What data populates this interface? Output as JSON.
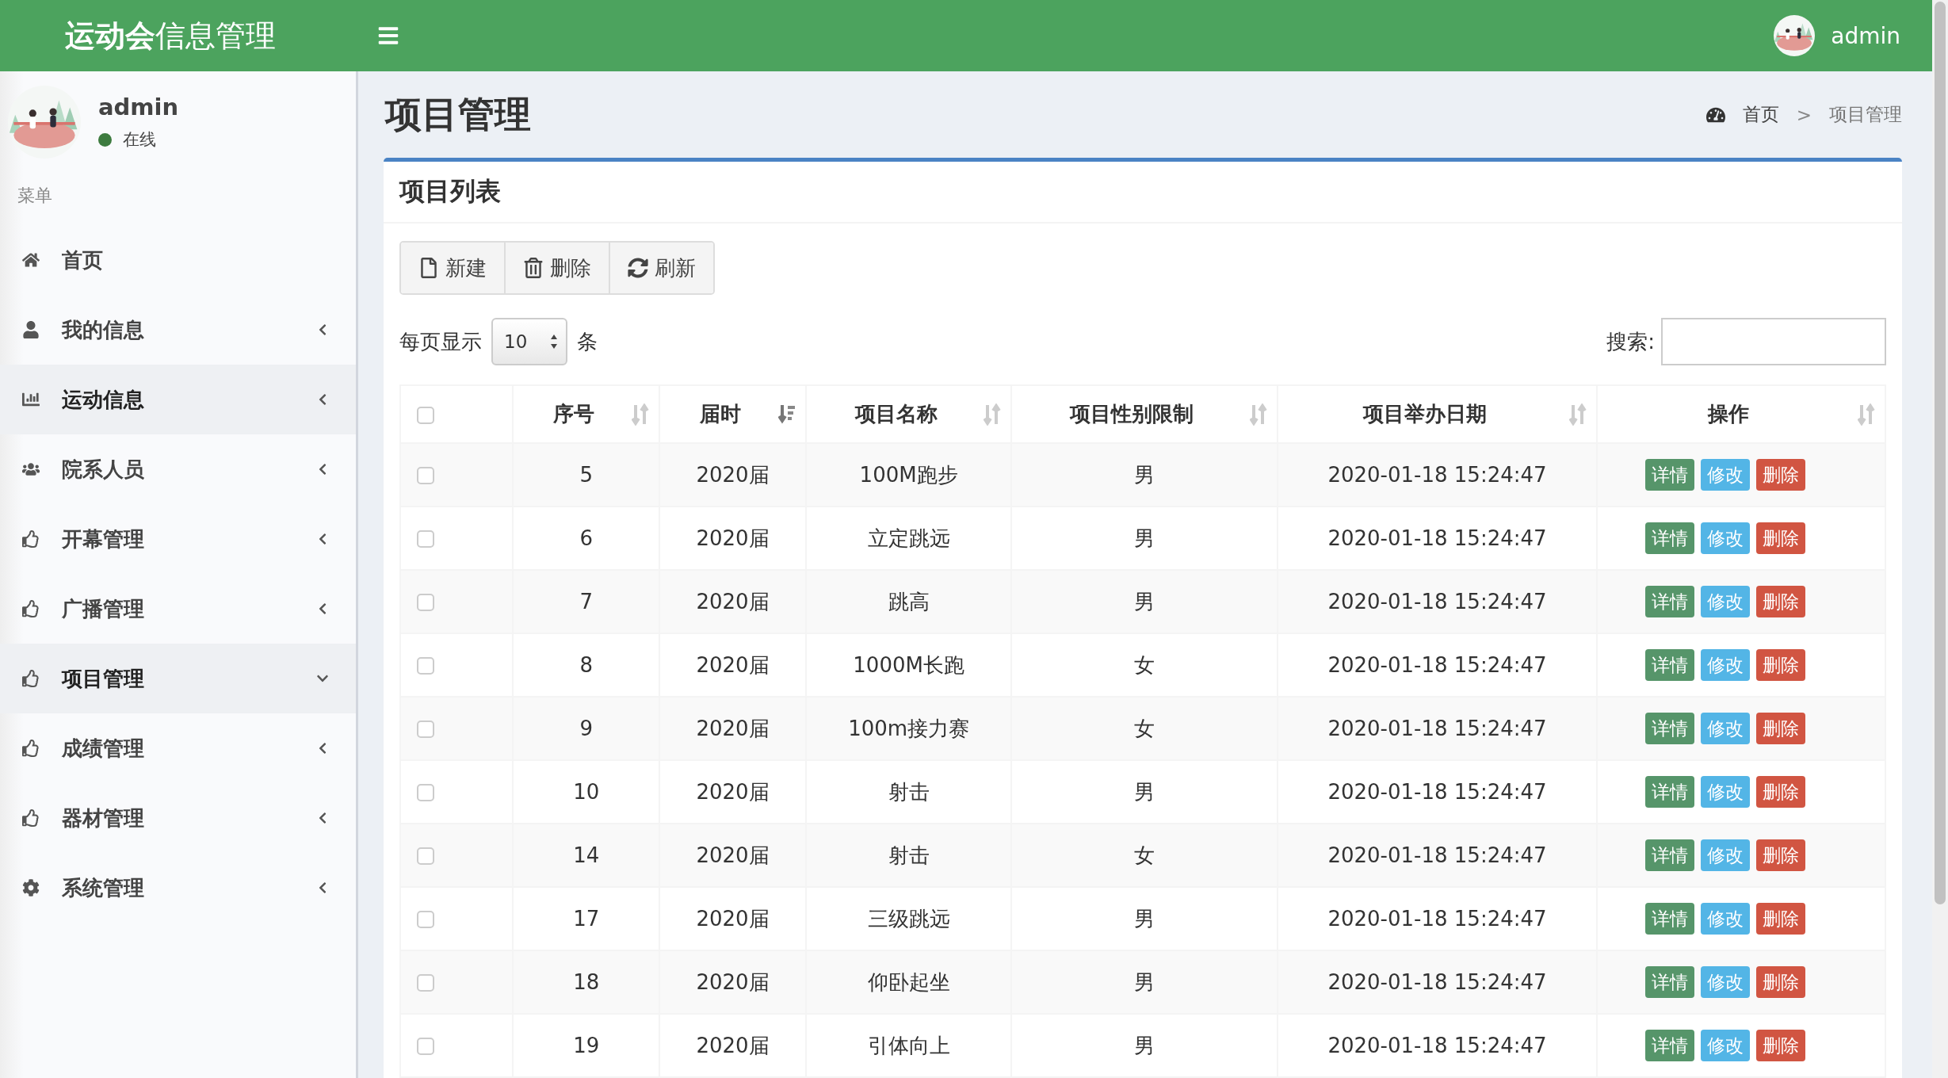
{
  "header": {
    "title": "**运动会**信息管理",
    "user": "admin"
  },
  "sidebar": {
    "user": {
      "name": "admin",
      "status": "在线"
    },
    "menu_label": "菜单",
    "items": [
      {
        "label": "首页",
        "highlighted": false
      },
      {
        "label": "我的信息",
        "highlighted": false,
        "expanded": false
      },
      {
        "label": "运动信息",
        "highlighted": true,
        "expanded": false
      },
      {
        "label": "院系人员",
        "highlighted": false,
        "expanded": false
      },
      {
        "label": "开幕管理",
        "highlighted": false,
        "expanded": false
      },
      {
        "label": "广播管理",
        "highlighted": false,
        "expanded": false
      },
      {
        "label": "项目管理",
        "highlighted": true,
        "expanded": true
      },
      {
        "label": "成绩管理",
        "highlighted": false,
        "expanded": false
      },
      {
        "label": "器材管理",
        "highlighted": false,
        "expanded": false
      },
      {
        "label": "系统管理",
        "highlighted": false,
        "expanded": false
      }
    ]
  },
  "page": {
    "title": "项目管理",
    "breadcrumb": {
      "home": "首页",
      "separator": ">",
      "current": "项目管理"
    }
  },
  "box": {
    "title": "项目列表",
    "toolbar": [
      "新建",
      "删除",
      "刷新"
    ],
    "page_size": {
      "prefix": "每页显示",
      "value": "10",
      "suffix": "条"
    },
    "search": {
      "label": "搜索:"
    },
    "table": {
      "all_checked": false,
      "columns": [
        {
          "label": "序号",
          "sorted": false
        },
        {
          "label": "届时",
          "sorted": true
        },
        {
          "label": "项目名称",
          "sorted": false
        },
        {
          "label": "项目性别限制",
          "sorted": false
        },
        {
          "label": "项目举办日期",
          "sorted": false
        },
        {
          "label": "操作",
          "sorted": false
        }
      ],
      "rows": [
        {
          "checked": false,
          "cells": [
            "5",
            "2020届",
            "100M跑步",
            "男",
            "2020-01-18 15:24:47"
          ],
          "actions": [
            {
              "label": "详情",
              "kind": "detail"
            },
            {
              "label": "修改",
              "kind": "edit"
            },
            {
              "label": "删除",
              "kind": "delete"
            }
          ]
        },
        {
          "checked": false,
          "cells": [
            "6",
            "2020届",
            "立定跳远",
            "男",
            "2020-01-18 15:24:47"
          ],
          "actions": [
            {
              "label": "详情",
              "kind": "detail"
            },
            {
              "label": "修改",
              "kind": "edit"
            },
            {
              "label": "删除",
              "kind": "delete"
            }
          ]
        },
        {
          "checked": false,
          "cells": [
            "7",
            "2020届",
            "跳高",
            "男",
            "2020-01-18 15:24:47"
          ],
          "actions": [
            {
              "label": "详情",
              "kind": "detail"
            },
            {
              "label": "修改",
              "kind": "edit"
            },
            {
              "label": "删除",
              "kind": "delete"
            }
          ]
        },
        {
          "checked": false,
          "cells": [
            "8",
            "2020届",
            "1000M长跑",
            "女",
            "2020-01-18 15:24:47"
          ],
          "actions": [
            {
              "label": "详情",
              "kind": "detail"
            },
            {
              "label": "修改",
              "kind": "edit"
            },
            {
              "label": "删除",
              "kind": "delete"
            }
          ]
        },
        {
          "checked": false,
          "cells": [
            "9",
            "2020届",
            "100m接力赛",
            "女",
            "2020-01-18 15:24:47"
          ],
          "actions": [
            {
              "label": "详情",
              "kind": "detail"
            },
            {
              "label": "修改",
              "kind": "edit"
            },
            {
              "label": "删除",
              "kind": "delete"
            }
          ]
        },
        {
          "checked": false,
          "cells": [
            "10",
            "2020届",
            "射击",
            "男",
            "2020-01-18 15:24:47"
          ],
          "actions": [
            {
              "label": "详情",
              "kind": "detail"
            },
            {
              "label": "修改",
              "kind": "edit"
            },
            {
              "label": "删除",
              "kind": "delete"
            }
          ]
        },
        {
          "checked": false,
          "cells": [
            "14",
            "2020届",
            "射击",
            "女",
            "2020-01-18 15:24:47"
          ],
          "actions": [
            {
              "label": "详情",
              "kind": "detail"
            },
            {
              "label": "修改",
              "kind": "edit"
            },
            {
              "label": "删除",
              "kind": "delete"
            }
          ]
        },
        {
          "checked": false,
          "cells": [
            "17",
            "2020届",
            "三级跳远",
            "男",
            "2020-01-18 15:24:47"
          ],
          "actions": [
            {
              "label": "详情",
              "kind": "detail"
            },
            {
              "label": "修改",
              "kind": "edit"
            },
            {
              "label": "删除",
              "kind": "delete"
            }
          ]
        },
        {
          "checked": false,
          "cells": [
            "18",
            "2020届",
            "仰卧起坐",
            "男",
            "2020-01-18 15:24:47"
          ],
          "actions": [
            {
              "label": "详情",
              "kind": "detail"
            },
            {
              "label": "修改",
              "kind": "edit"
            },
            {
              "label": "删除",
              "kind": "delete"
            }
          ]
        },
        {
          "checked": false,
          "cells": [
            "19",
            "2020届",
            "引体向上",
            "男",
            "2020-01-18 15:24:47"
          ],
          "actions": [
            {
              "label": "详情",
              "kind": "detail"
            },
            {
              "label": "修改",
              "kind": "edit"
            },
            {
              "label": "删除",
              "kind": "delete"
            }
          ]
        }
      ]
    }
  }
}
